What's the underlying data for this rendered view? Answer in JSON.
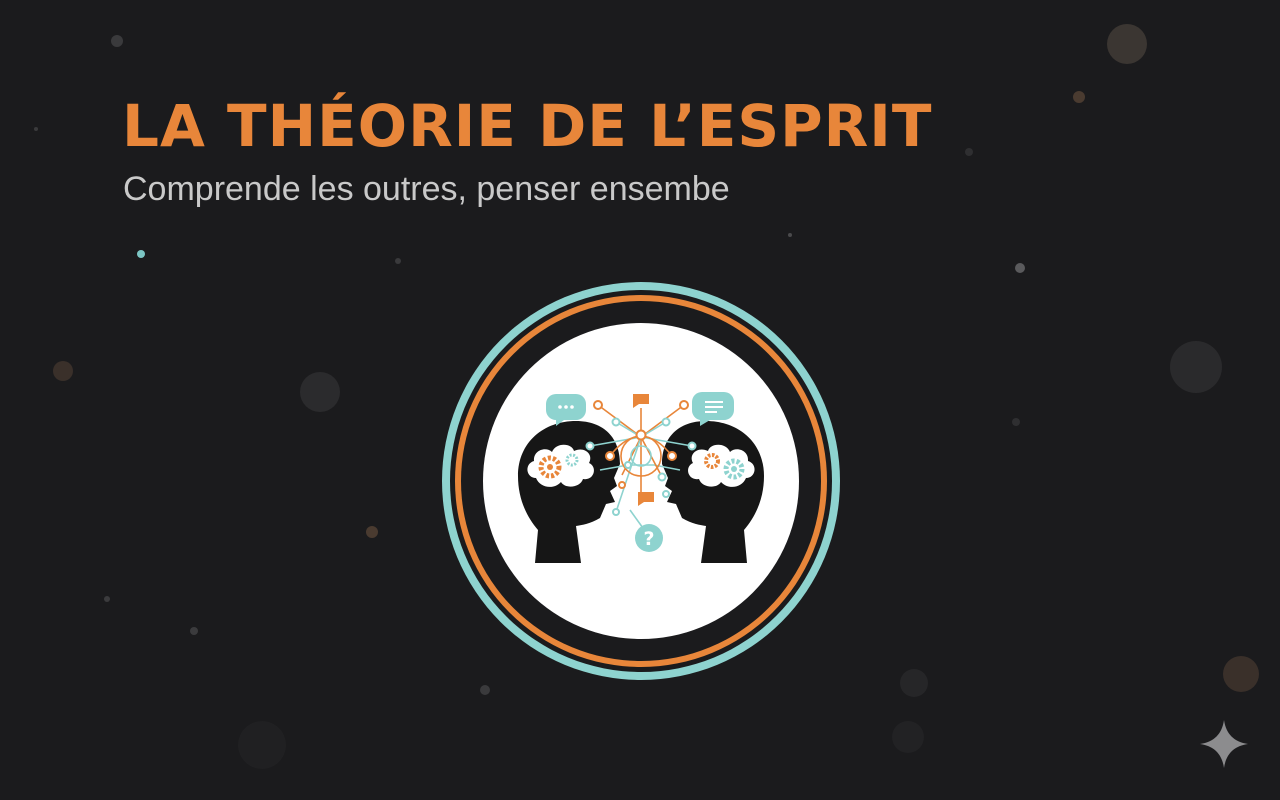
{
  "header": {
    "title": "LA THÉORIE DE L’ESPRIT",
    "subtitle": "Comprende les outres, penser ensembe"
  },
  "emblem": {
    "question_glyph": "?",
    "icons": [
      "head-silhouette-icon",
      "brain-cloud-icon",
      "gear-icon",
      "speech-bubble-icon",
      "network-icon",
      "question-icon"
    ]
  },
  "colors": {
    "background": "#1b1b1d",
    "accent_orange": "#e8863a",
    "accent_teal": "#8ed3cf",
    "subtitle_gray": "#c9c9c9"
  }
}
